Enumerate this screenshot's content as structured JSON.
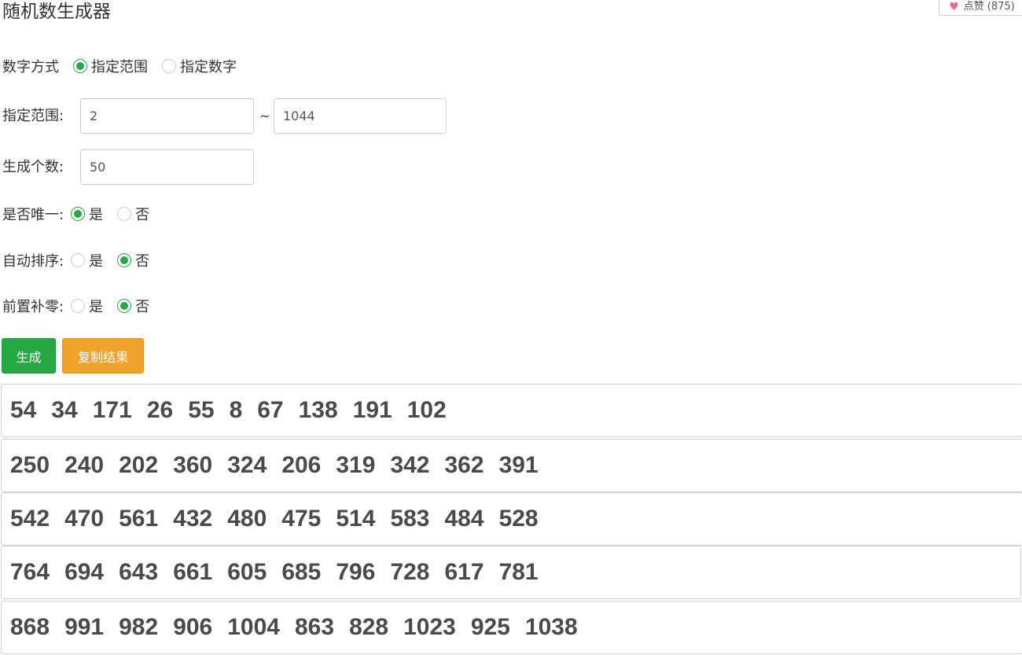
{
  "title": "随机数生成器",
  "like": {
    "label": "点赞",
    "count": "(875)"
  },
  "mode": {
    "label": "数字方式",
    "options": [
      "指定范围",
      "指定数字"
    ],
    "selected": 0
  },
  "range": {
    "label": "指定范围:",
    "min": "2",
    "separator": "~",
    "max": "1044"
  },
  "count": {
    "label": "生成个数:",
    "value": "50"
  },
  "unique": {
    "label": "是否唯一:",
    "yes": "是",
    "no": "否",
    "selected": "yes"
  },
  "sort": {
    "label": "自动排序:",
    "yes": "是",
    "no": "否",
    "selected": "no"
  },
  "pad": {
    "label": "前置补零:",
    "yes": "是",
    "no": "否",
    "selected": "no"
  },
  "buttons": {
    "generate": "生成",
    "copy": "复制结果"
  },
  "accent_green": "#28a745",
  "accent_orange": "#f0a32a",
  "results": [
    [
      "54",
      "34",
      "171",
      "26",
      "55",
      "8",
      "67",
      "138",
      "191",
      "102"
    ],
    [
      "250",
      "240",
      "202",
      "360",
      "324",
      "206",
      "319",
      "342",
      "362",
      "391"
    ],
    [
      "542",
      "470",
      "561",
      "432",
      "480",
      "475",
      "514",
      "583",
      "484",
      "528"
    ],
    [
      "764",
      "694",
      "643",
      "661",
      "605",
      "685",
      "796",
      "728",
      "617",
      "781"
    ],
    [
      "868",
      "991",
      "982",
      "906",
      "1004",
      "863",
      "828",
      "1023",
      "925",
      "1038"
    ]
  ]
}
